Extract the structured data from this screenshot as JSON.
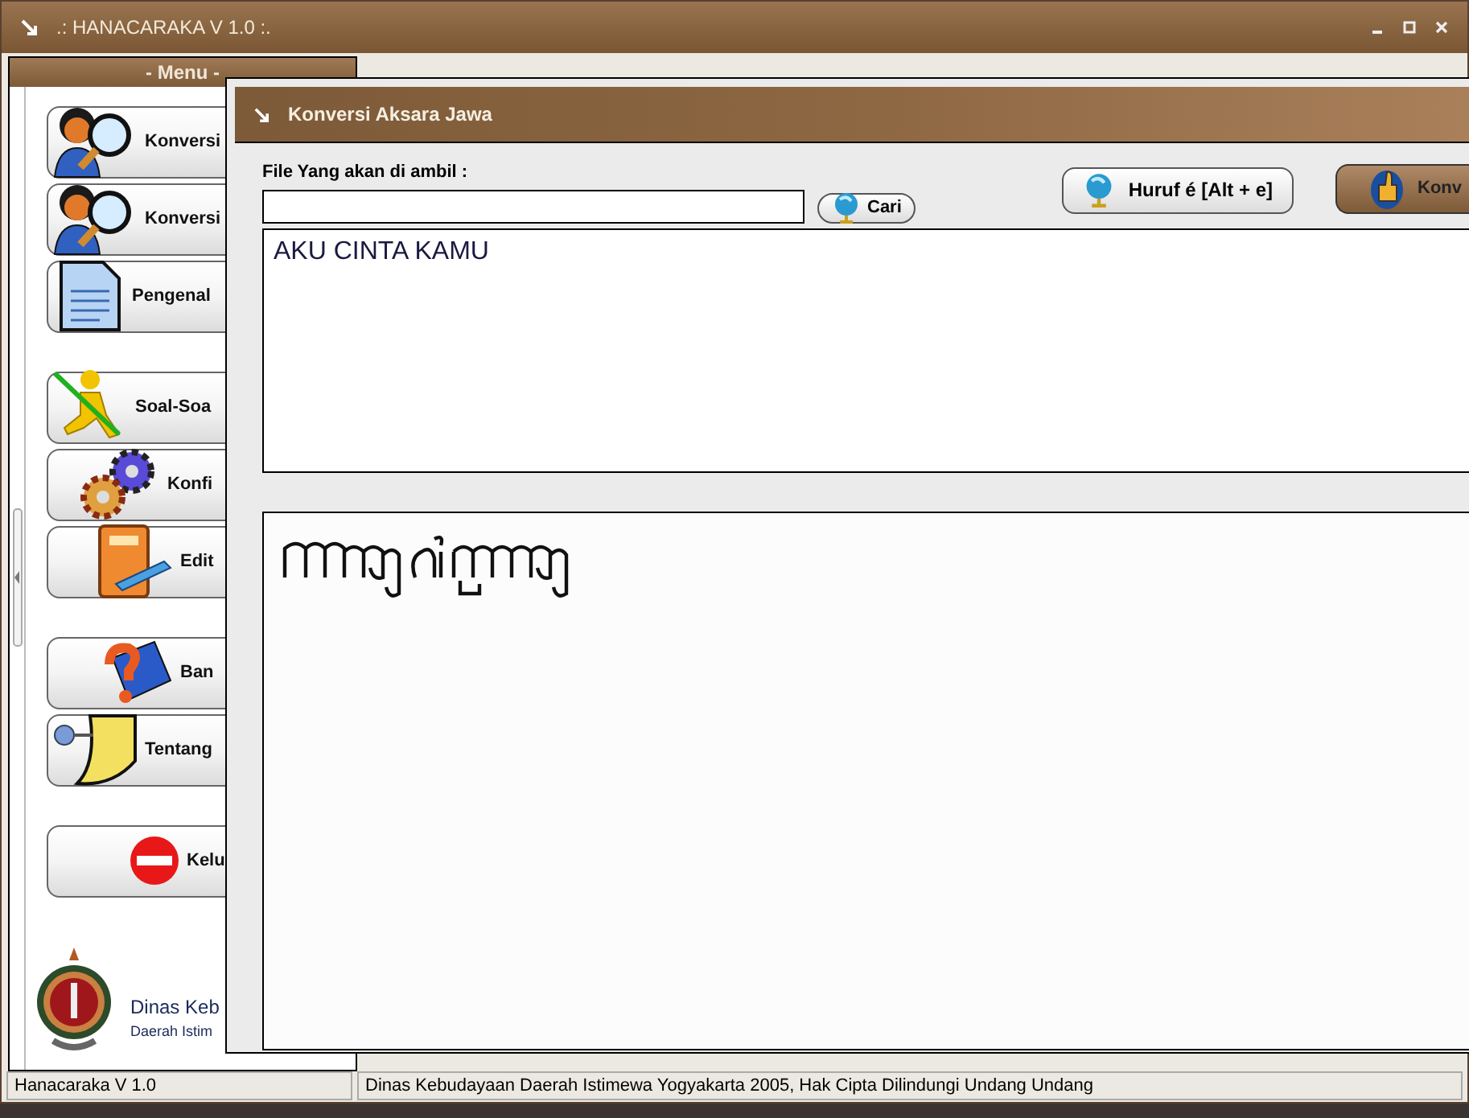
{
  "window": {
    "title": ".: HANACARAKA V 1.0 :."
  },
  "menu": {
    "title": "- Menu -",
    "groups": [
      [
        {
          "kind": "search-person",
          "label": "Konversi"
        },
        {
          "kind": "search-person",
          "label": "Konversi"
        },
        {
          "kind": "document",
          "label": "Pengenal"
        }
      ],
      [
        {
          "kind": "runner",
          "label": "Soal-Soa"
        },
        {
          "kind": "gears",
          "label": "Konfi"
        },
        {
          "kind": "book-pen",
          "label": "Edit"
        }
      ],
      [
        {
          "kind": "help-book",
          "label": "Ban"
        },
        {
          "kind": "note-pin",
          "label": "Tentang"
        }
      ],
      [
        {
          "kind": "stop",
          "label": "Kelu"
        }
      ]
    ],
    "footer": {
      "line_1": "Dinas Keb",
      "line_2": "Daerah Istim"
    }
  },
  "dialog": {
    "title": "Konversi Aksara Jawa",
    "file_label": "File Yang akan di ambil :",
    "browse_button": "Cari",
    "letter_button": "Huruf é [Alt + e]",
    "convert_button": "Konv",
    "input_text": "AKU CINTA KAMU"
  },
  "status_bar": [
    "Hanacaraka V 1.0",
    "Dinas Kebudayaan Daerah Istimewa Yogyakarta 2005, Hak Cipta Dilindungi Undang Undang"
  ]
}
